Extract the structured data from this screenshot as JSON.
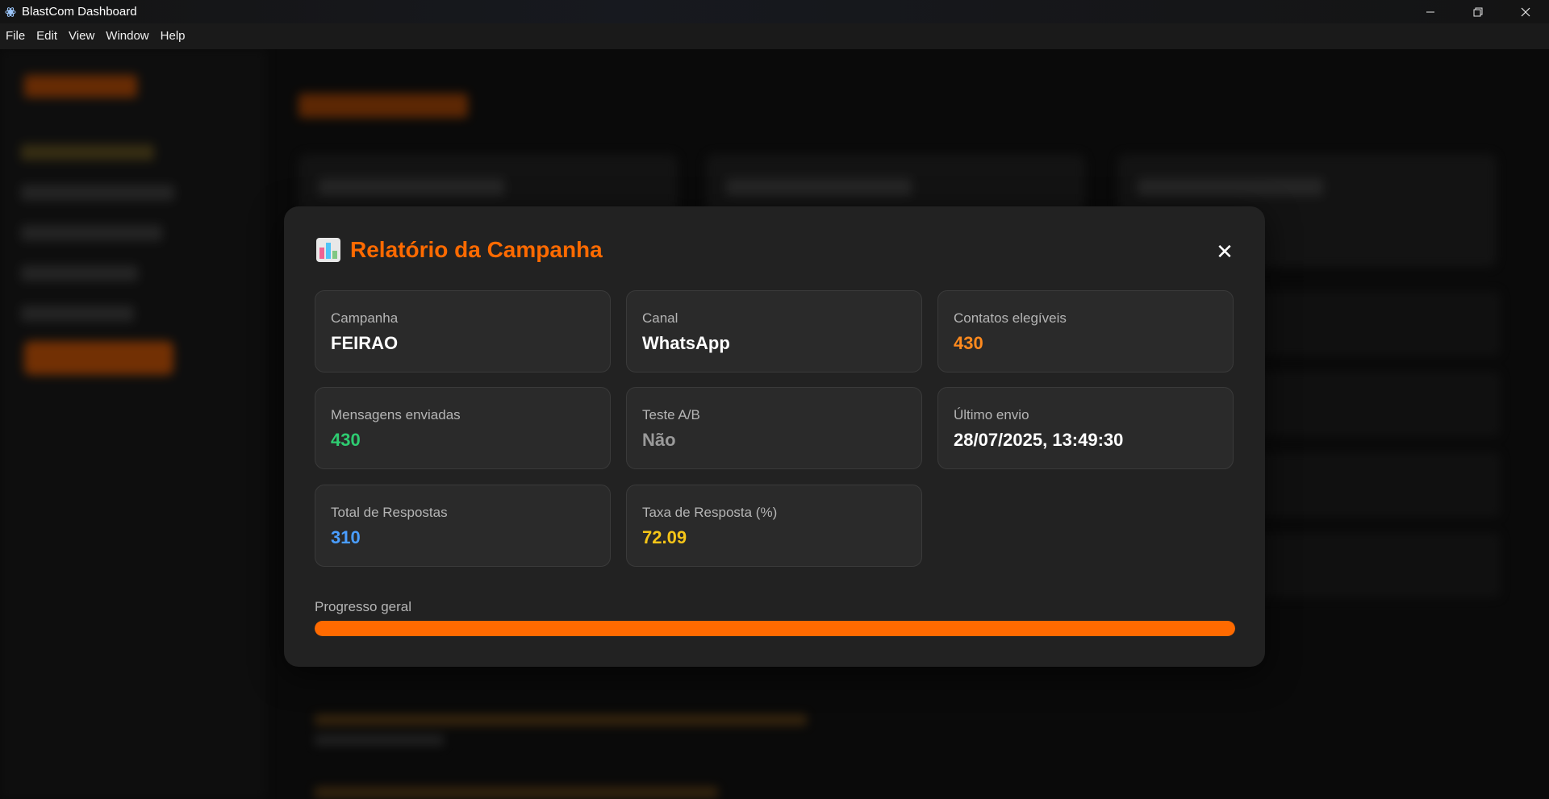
{
  "window": {
    "title": "BlastCom Dashboard",
    "controls": [
      "minimize",
      "restore",
      "close"
    ]
  },
  "menu": {
    "items": [
      "File",
      "Edit",
      "View",
      "Window",
      "Help"
    ]
  },
  "modal": {
    "icon": "bar-chart-icon",
    "title": "Relatório da Campanha",
    "close_label": "✕",
    "cards": [
      {
        "label": "Campanha",
        "value": "FEIRAO",
        "color": "#ffffff"
      },
      {
        "label": "Canal",
        "value": "WhatsApp",
        "color": "#ffffff"
      },
      {
        "label": "Contatos elegíveis",
        "value": "430",
        "color": "#ff8a1e"
      },
      {
        "label": "Mensagens enviadas",
        "value": "430",
        "color": "#2ecc71"
      },
      {
        "label": "Teste A/B",
        "value": "Não",
        "color": "#9a9a9a"
      },
      {
        "label": "Último envio",
        "value": "28/07/2025, 13:49:30",
        "color": "#ffffff"
      },
      {
        "label": "Total de Respostas",
        "value": "310",
        "color": "#4a9eff"
      },
      {
        "label": "Taxa de Resposta (%)",
        "value": "72.09",
        "color": "#f5c518"
      }
    ],
    "progress": {
      "label": "Progresso geral",
      "percent": 100,
      "color": "#ff6a00"
    }
  }
}
